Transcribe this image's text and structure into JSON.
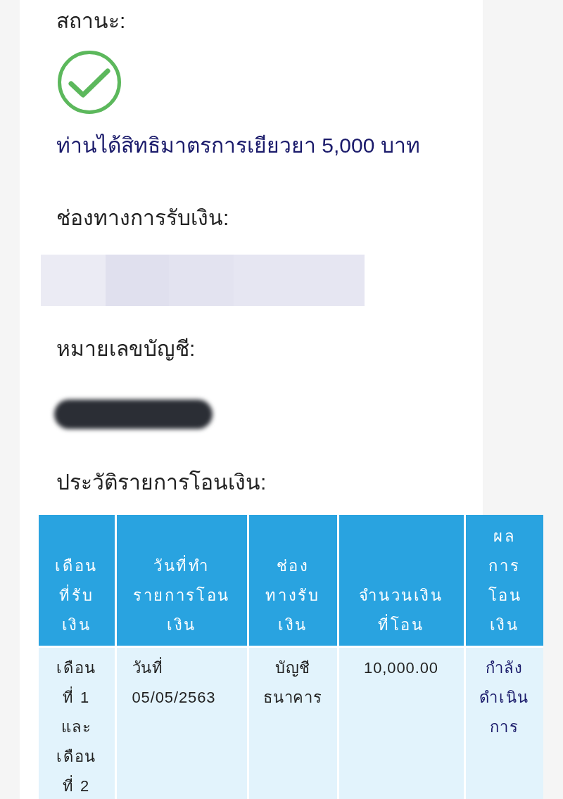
{
  "status": {
    "label": "สถานะ:",
    "approved": true,
    "message": "ท่านได้สิทธิมาตรการเยียวยา 5,000 บาท"
  },
  "payment_channel": {
    "label": "ช่องทางการรับเงิน:"
  },
  "account_number": {
    "label": "หมายเลขบัญชี:"
  },
  "transfer_history": {
    "label": "ประวัติรายการโอนเงิน:",
    "table": {
      "columns": [
        "เดือนที่รับเงิน",
        "วันที่ทำรายการโอนเงิน",
        "ช่องทางรับเงิน",
        "จำนวนเงินที่โอน",
        "ผลการโอนเงิน"
      ],
      "rows": [
        {
          "cells": [
            "เดือนที่ 1 และเดือนที่ 2",
            "วันที่ 05/05/2563",
            "บัญชีธนาคาร",
            "10,000.00",
            "กำลังดำเนินการ"
          ]
        }
      ]
    }
  }
}
